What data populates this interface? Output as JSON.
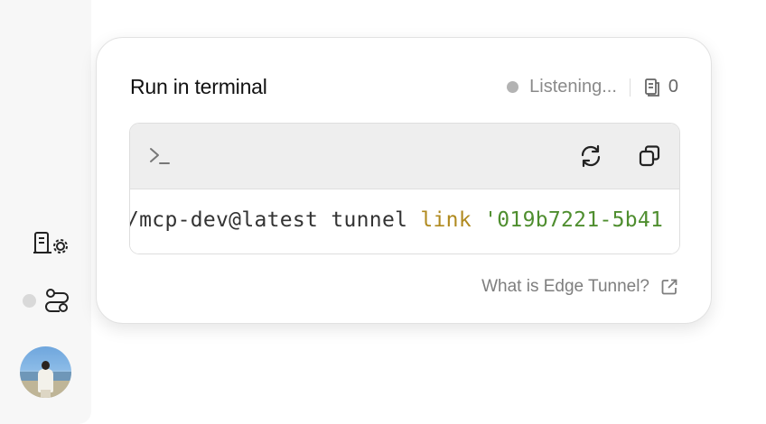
{
  "sidebar": {
    "icons": [
      "settings-document-icon",
      "route-icon"
    ],
    "avatar_alt": "user avatar"
  },
  "card": {
    "title": "Run in terminal",
    "status": {
      "label": "Listening...",
      "count": "0"
    },
    "terminal": {
      "prompt_icon": "terminal-prompt-icon",
      "command_parts": {
        "prefix": "/mcp-dev@latest tunnel ",
        "keyword": "link",
        "space": " ",
        "argument": "'019b7221-5b41"
      }
    },
    "help_link": "What is Edge Tunnel?"
  },
  "colors": {
    "keyword": "#b08a1f",
    "string": "#4f8e2f",
    "status_dot": "#b3b3b3"
  }
}
